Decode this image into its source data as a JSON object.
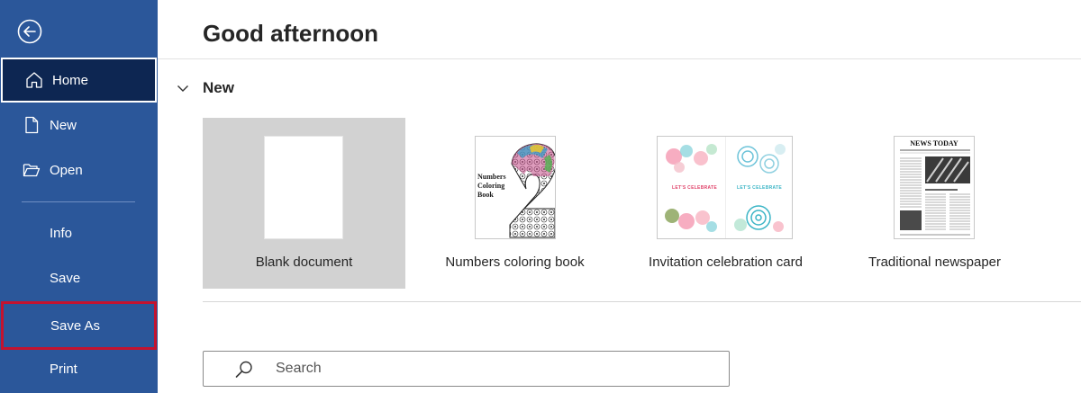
{
  "sidebar": {
    "back_icon": "back-arrow-icon",
    "items": [
      {
        "label": "Home",
        "icon": "home-icon",
        "state": "selected"
      },
      {
        "label": "New",
        "icon": "new-document-icon"
      },
      {
        "label": "Open",
        "icon": "folder-open-icon"
      },
      {
        "label": "Info"
      },
      {
        "label": "Save"
      },
      {
        "label": "Save As",
        "state": "highlighted"
      },
      {
        "label": "Print"
      }
    ],
    "colors": {
      "background": "#2b579a",
      "selected": "#0d2652",
      "highlight_border": "#c4132f"
    }
  },
  "main": {
    "greeting": "Good afternoon",
    "new_section": {
      "title": "New",
      "expanded": true,
      "templates": [
        {
          "label": "Blank document",
          "selected": true
        },
        {
          "label": "Numbers coloring book",
          "thumb_text": [
            "Numbers",
            "Coloring",
            "Book"
          ]
        },
        {
          "label": "Invitation celebration card",
          "thumb_text": [
            "LET'S CELEBRATE",
            "LET'S CELEBRATE"
          ]
        },
        {
          "label": "Traditional newspaper",
          "thumb_text": "NEWS TODAY"
        }
      ]
    },
    "search": {
      "placeholder": "Search",
      "value": ""
    }
  }
}
